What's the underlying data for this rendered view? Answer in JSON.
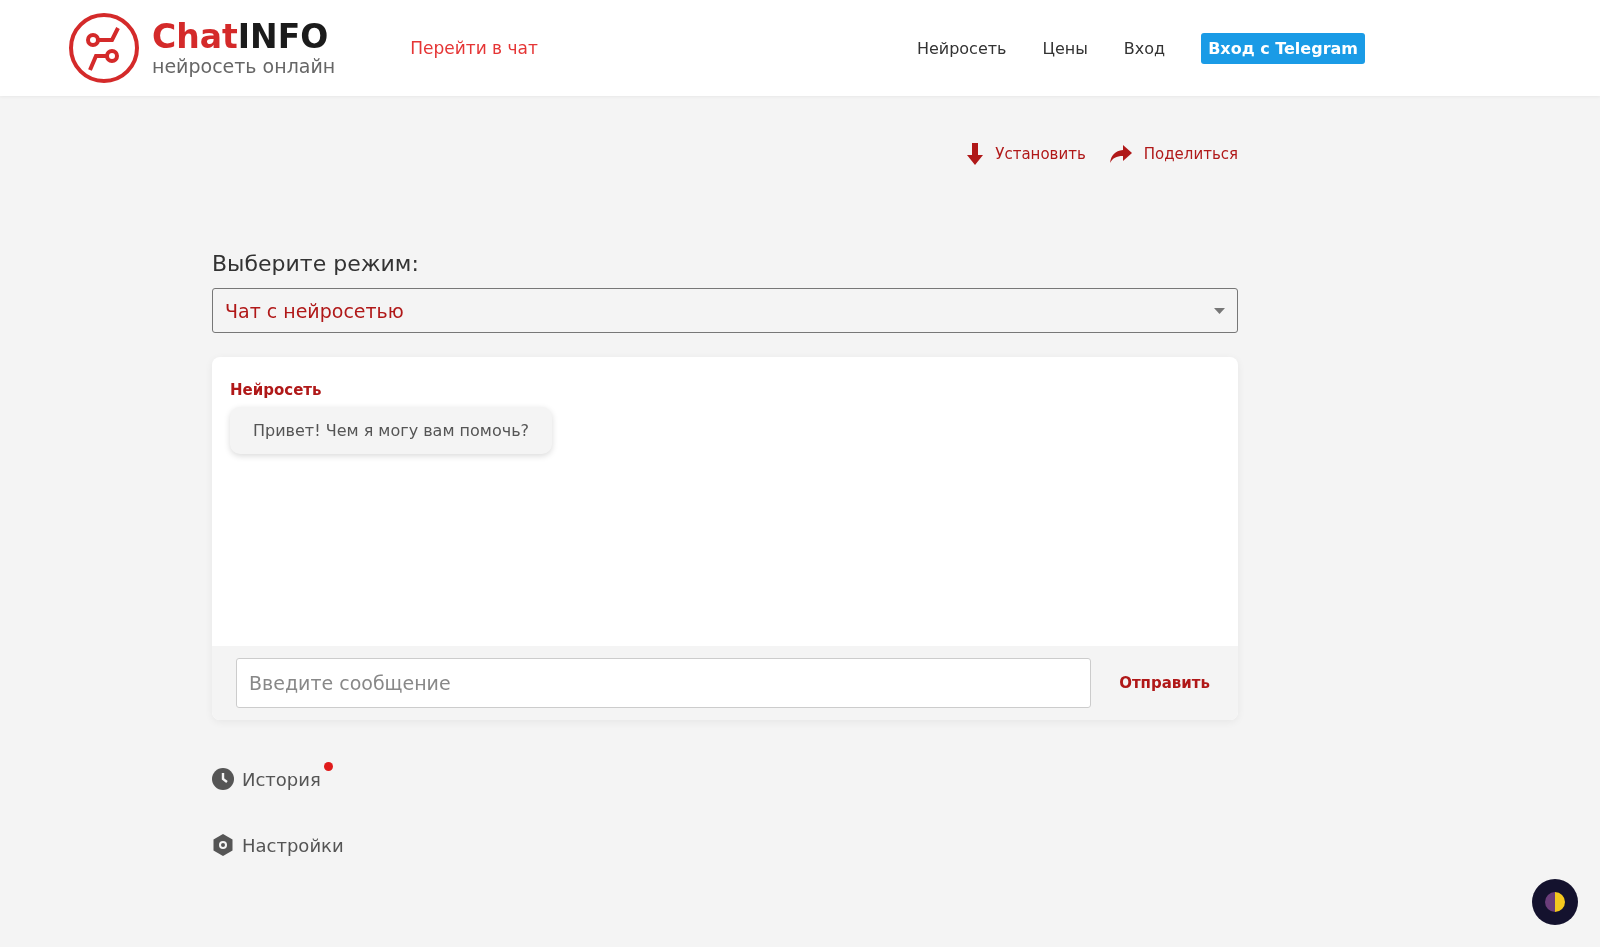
{
  "header": {
    "logo": {
      "brand_a": "Chat",
      "brand_b": "INFO",
      "tagline": "нейросеть онлайн"
    },
    "chat_link": "Перейти в чат",
    "nav": [
      "Нейросеть",
      "Цены",
      "Вход"
    ],
    "telegram_button": "Вход с Telegram"
  },
  "actions": [
    {
      "kind": "install",
      "label": "Установить"
    },
    {
      "kind": "share",
      "label": "Поделиться"
    }
  ],
  "mode": {
    "label": "Выберите режим:",
    "value": "Чат с нейросетью"
  },
  "chat": {
    "messages": [
      {
        "sender": "Нейросеть",
        "text": "Привет! Чем я могу вам помочь?"
      }
    ],
    "input": {
      "placeholder": "Введите сообщение"
    },
    "send_button": "Отправить"
  },
  "menu": [
    {
      "kind": "history",
      "label": "История",
      "notification": true
    },
    {
      "kind": "settings",
      "label": "Настройки",
      "notification": false
    }
  ]
}
